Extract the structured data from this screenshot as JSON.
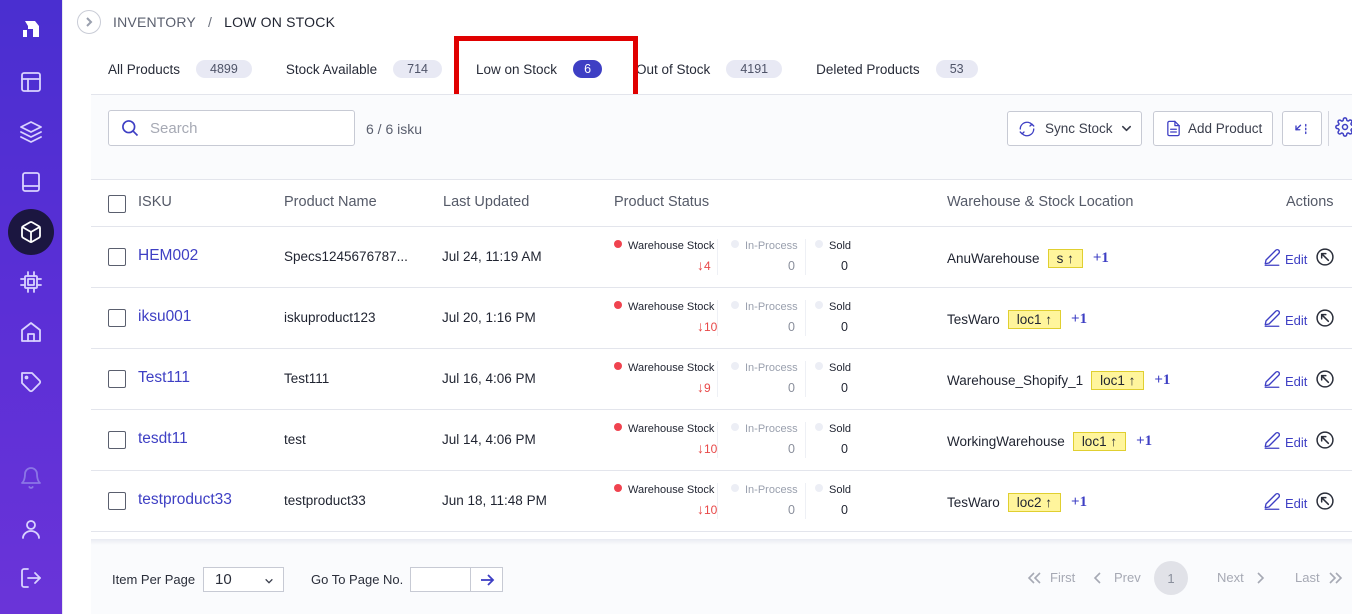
{
  "breadcrumb": {
    "parent": "INVENTORY",
    "separator": "/",
    "current": "LOW ON STOCK"
  },
  "tabs": [
    {
      "label": "All Products",
      "count": "4899"
    },
    {
      "label": "Stock Available",
      "count": "714"
    },
    {
      "label": "Low on Stock",
      "count": "6",
      "active": true
    },
    {
      "label": "Out of Stock",
      "count": "4191"
    },
    {
      "label": "Deleted Products",
      "count": "53"
    }
  ],
  "search": {
    "placeholder": "Search",
    "value": ""
  },
  "isku_count": "6 / 6 isku",
  "toolbar": {
    "sync_label": "Sync Stock",
    "add_label": "Add Product"
  },
  "table": {
    "headers": {
      "isku": "ISKU",
      "name": "Product Name",
      "updated": "Last Updated",
      "status": "Product Status",
      "warehouse": "Warehouse & Stock Location",
      "actions": "Actions"
    },
    "status_labels": {
      "warehouse": "Warehouse Stock",
      "in_process": "In-Process",
      "sold": "Sold"
    },
    "edit_label": "Edit",
    "rows": [
      {
        "isku": "HEM002",
        "name": "Specs1245676787...",
        "updated": "Jul 24, 11:19 AM",
        "wh_stock": "4",
        "in_process": "0",
        "sold": "0",
        "warehouse": "AnuWarehouse",
        "location": "s",
        "extra": "+1"
      },
      {
        "isku": "iksu001",
        "name": "iskuproduct123",
        "updated": "Jul 20, 1:16 PM",
        "wh_stock": "10",
        "in_process": "0",
        "sold": "0",
        "warehouse": "TesWaro",
        "location": "loc1",
        "extra": "+1"
      },
      {
        "isku": "Test111",
        "name": "Test111",
        "updated": "Jul 16, 4:06 PM",
        "wh_stock": "9",
        "in_process": "0",
        "sold": "0",
        "warehouse": "Warehouse_Shopify_1",
        "location": "loc1",
        "extra": "+1"
      },
      {
        "isku": "tesdt11",
        "name": "test",
        "updated": "Jul 14, 4:06 PM",
        "wh_stock": "10",
        "in_process": "0",
        "sold": "0",
        "warehouse": "WorkingWarehouse",
        "location": "loc1",
        "extra": "+1"
      },
      {
        "isku": "testproduct33",
        "name": "testproduct33",
        "updated": "Jun 18, 11:48 PM",
        "wh_stock": "10",
        "in_process": "0",
        "sold": "0",
        "warehouse": "TesWaro",
        "location": "loc2",
        "extra": "+1"
      }
    ]
  },
  "footer": {
    "items_per_page_label": "Item Per Page",
    "items_per_page_value": "10",
    "goto_label": "Go To Page No.",
    "first": "First",
    "prev": "Prev",
    "current_page": "1",
    "next": "Next",
    "last": "Last"
  },
  "colors": {
    "accent": "#3e3fc4",
    "sidebar": "#5b2fd6",
    "low_stock": "#e84848",
    "location_tag": "#fff59c",
    "highlight": "#e00000"
  },
  "icons": {
    "sidebar": [
      "logo-icon",
      "dashboard-icon",
      "layers-icon",
      "book-icon",
      "inventory-box-icon",
      "chip-icon",
      "home-icon",
      "tag-icon",
      "bell-icon",
      "user-icon",
      "logout-icon"
    ]
  }
}
